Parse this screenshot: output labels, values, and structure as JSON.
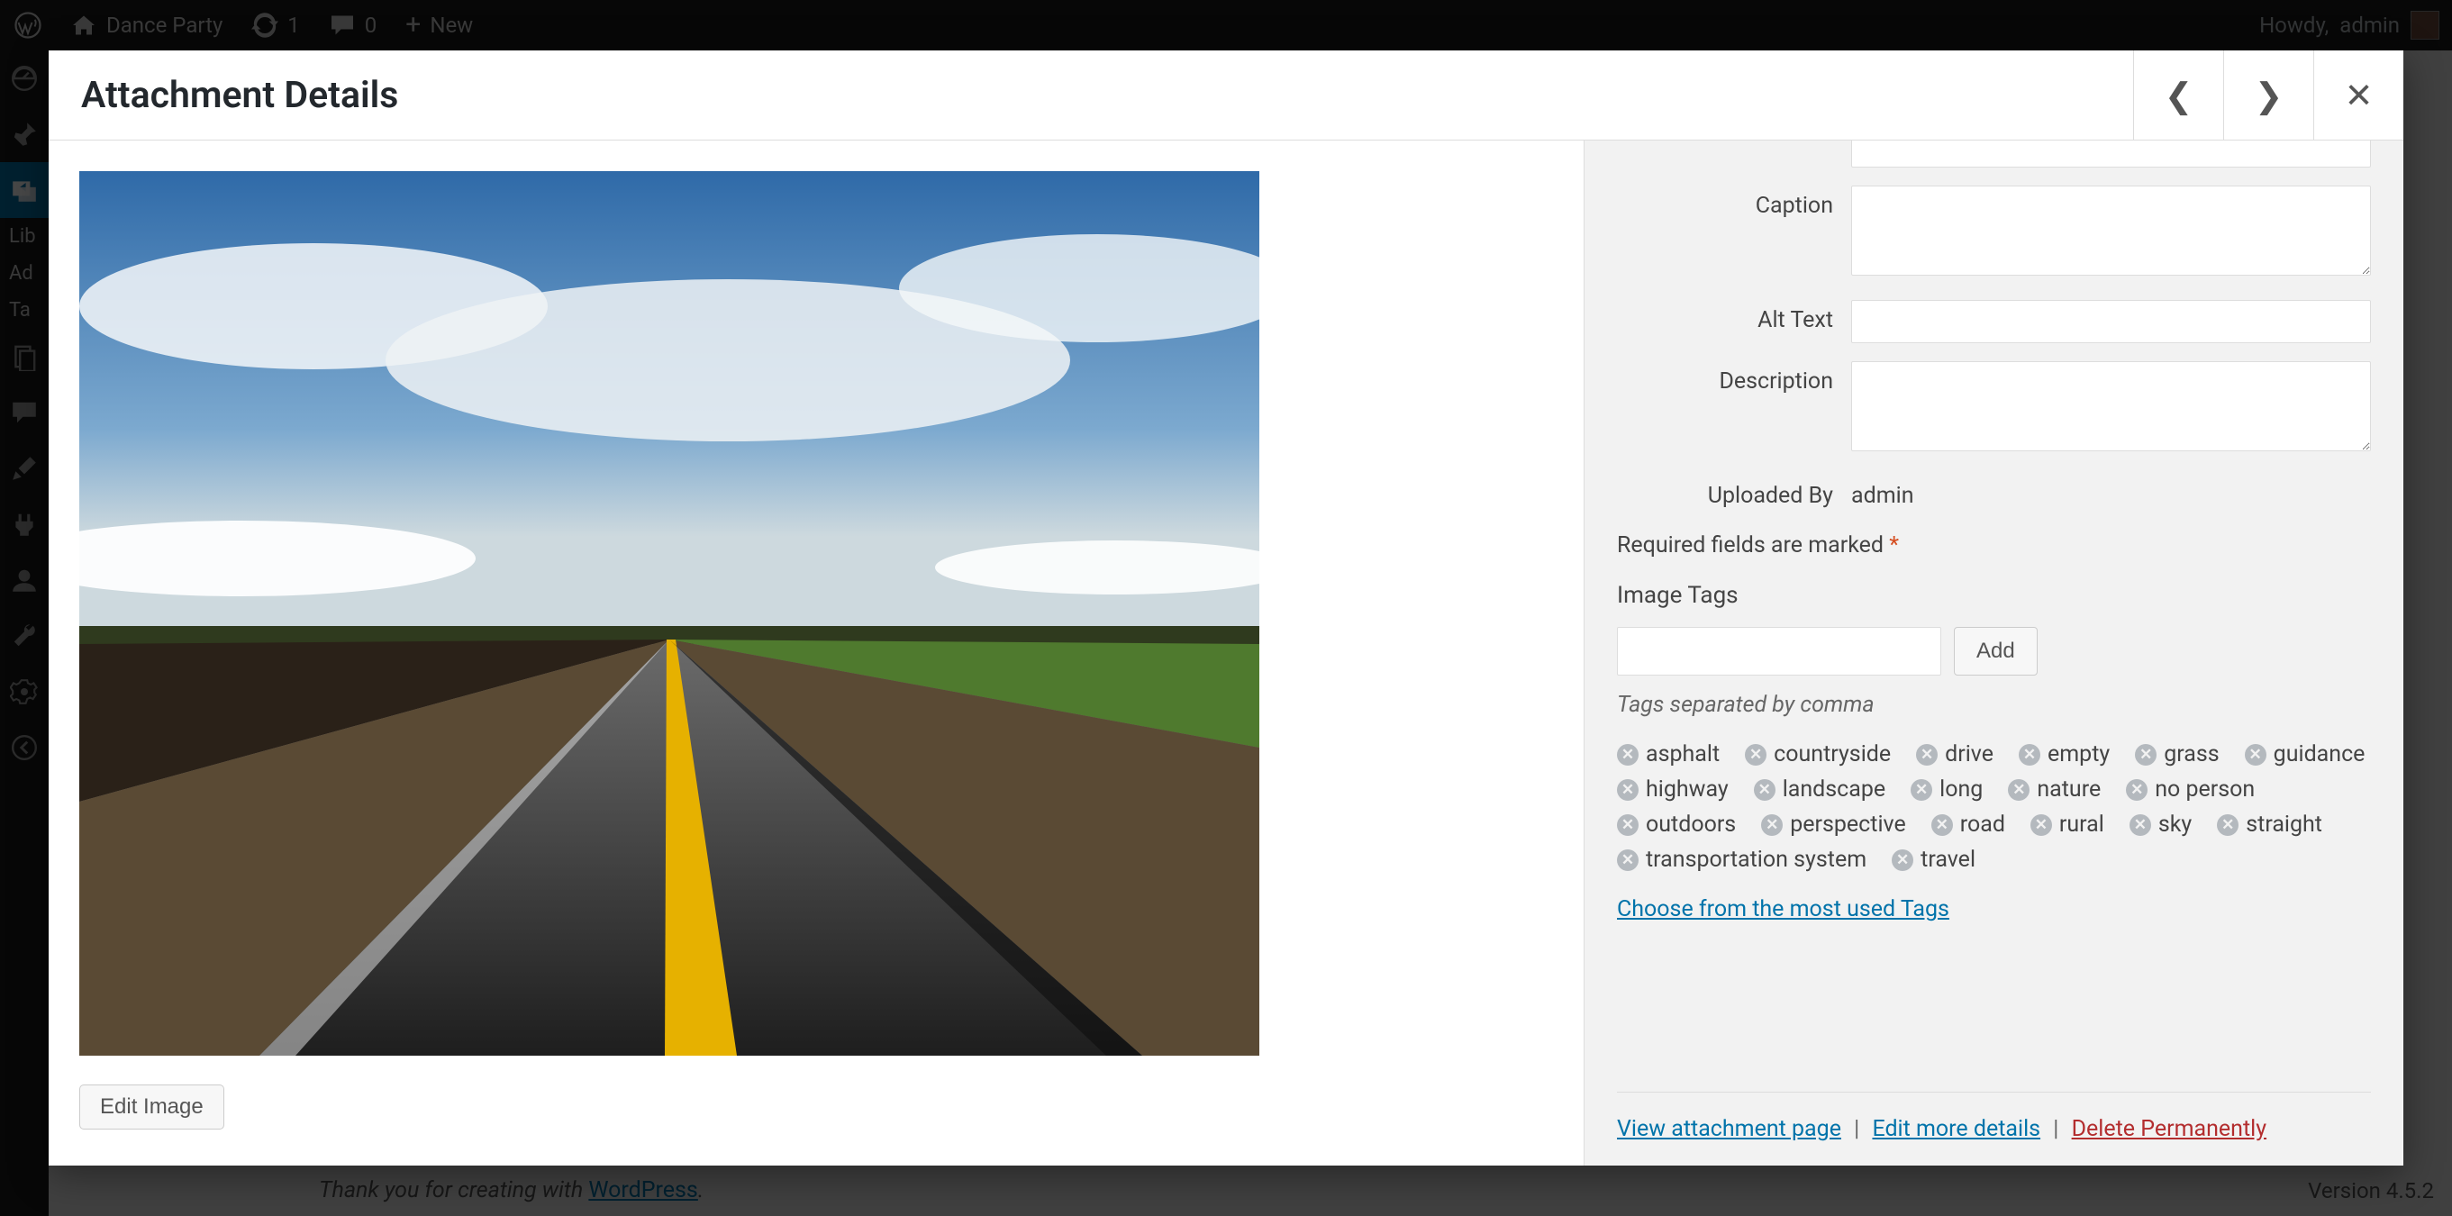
{
  "adminbar": {
    "site_name": "Dance Party",
    "updates_count": "1",
    "comments_count": "0",
    "new_label": "New",
    "howdy_prefix": "Howdy,",
    "howdy_user": "admin"
  },
  "adminmenu": {
    "sub_items": [
      "Lib",
      "Ad",
      "Ta"
    ]
  },
  "footer": {
    "thanks_prefix": "Thank you for creating with ",
    "thanks_link": "WordPress",
    "thanks_suffix": ".",
    "version": "Version 4.5.2"
  },
  "modal": {
    "title": "Attachment Details",
    "edit_image_label": "Edit Image",
    "fields": {
      "caption_label": "Caption",
      "alt_label": "Alt Text",
      "desc_label": "Description",
      "uploaded_by_label": "Uploaded By",
      "uploaded_by_value": "admin"
    },
    "required_note": "Required fields are marked ",
    "required_star": "*",
    "tags_section": {
      "heading": "Image Tags",
      "add_label": "Add",
      "help": "Tags separated by comma",
      "tags": [
        "asphalt",
        "countryside",
        "drive",
        "empty",
        "grass",
        "guidance",
        "highway",
        "landscape",
        "long",
        "nature",
        "no person",
        "outdoors",
        "perspective",
        "road",
        "rural",
        "sky",
        "straight",
        "transportation system",
        "travel"
      ],
      "most_used": "Choose from the most used Tags"
    },
    "actions": {
      "view": "View attachment page",
      "edit_more": "Edit more details",
      "delete": "Delete Permanently"
    }
  }
}
